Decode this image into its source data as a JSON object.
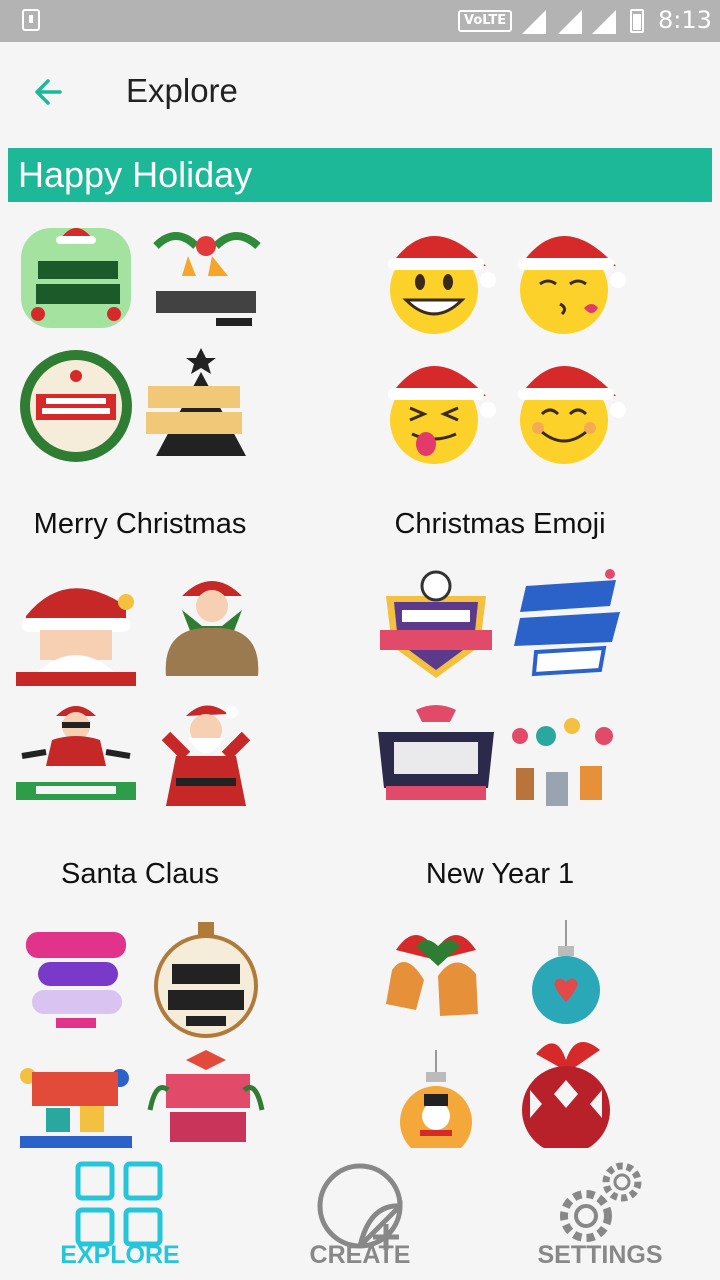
{
  "status_bar": {
    "time": "8:13",
    "network_badge": "VoLTE"
  },
  "app_bar": {
    "title": "Explore",
    "back_icon": "arrow-left-icon"
  },
  "section": {
    "title": "Happy Holiday"
  },
  "packs": [
    {
      "name": "Merry Christmas"
    },
    {
      "name": "Christmas Emoji"
    },
    {
      "name": "Santa Claus"
    },
    {
      "name": "New Year 1"
    }
  ],
  "bottom_nav": {
    "items": [
      {
        "label": "EXPLORE",
        "icon": "grid-icon",
        "active": true
      },
      {
        "label": "CREATE",
        "icon": "sticker-add-icon",
        "active": false
      },
      {
        "label": "SETTINGS",
        "icon": "gears-icon",
        "active": false
      }
    ]
  },
  "colors": {
    "accent": "#1db898",
    "active_nav": "#26c6da",
    "inactive_nav": "#888888"
  }
}
